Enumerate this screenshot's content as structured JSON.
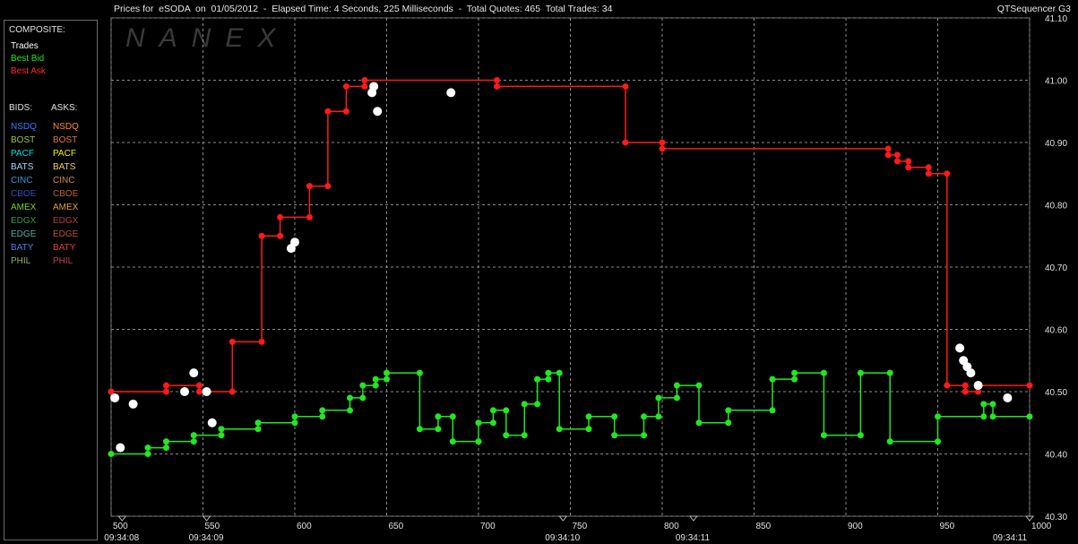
{
  "header": {
    "title": "Prices for  eSODA  on  01/05/2012  -  Elapsed Time: 4 Seconds, 225 Milliseconds  -  Total Quotes: 465  Total Trades: 34",
    "app": "QTSequencer G3"
  },
  "watermark": "NANEX",
  "legend": {
    "composite_title": "COMPOSITE:",
    "trades": "Trades",
    "best_bid": "Best Bid",
    "best_ask": "Best Ask",
    "bids_title": "BIDS:",
    "asks_title": "ASKS:",
    "exchanges": [
      {
        "bid": "NSDQ",
        "ask": "NSDQ",
        "bid_color": "#3a78ff",
        "ask_color": "#ff8a2a"
      },
      {
        "bid": "BOST",
        "ask": "BOST",
        "bid_color": "#9acd32",
        "ask_color": "#e0783a"
      },
      {
        "bid": "PACF",
        "ask": "PACF",
        "bid_color": "#00e0e0",
        "ask_color": "#f0f000"
      },
      {
        "bid": "BATS",
        "ask": "BATS",
        "bid_color": "#a0d8ff",
        "ask_color": "#f0d060"
      },
      {
        "bid": "CINC",
        "ask": "CINC",
        "bid_color": "#3a9bd0",
        "ask_color": "#d08a50"
      },
      {
        "bid": "CBOE",
        "ask": "CBOE",
        "bid_color": "#3050b0",
        "ask_color": "#c06020"
      },
      {
        "bid": "AMEX",
        "ask": "AMEX",
        "bid_color": "#7ad028",
        "ask_color": "#e0a030"
      },
      {
        "bid": "EDGX",
        "ask": "EDGX",
        "bid_color": "#2e9a50",
        "ask_color": "#b04040"
      },
      {
        "bid": "EDGE",
        "ask": "EDGE",
        "bid_color": "#50b0a0",
        "ask_color": "#c05030"
      },
      {
        "bid": "BATY",
        "ask": "BATY",
        "bid_color": "#4080e0",
        "ask_color": "#e04040"
      },
      {
        "bid": "PHIL",
        "ask": "PHIL",
        "bid_color": "#90b060",
        "ask_color": "#c04050"
      }
    ]
  },
  "colors": {
    "trades": "#ffffff",
    "best_bid": "#22e622",
    "best_ask": "#ff1a1a",
    "grid": "#8a8a8a"
  },
  "chart_data": {
    "type": "line",
    "x_ticks": [
      500,
      550,
      600,
      650,
      700,
      750,
      800,
      850,
      900,
      950,
      1000
    ],
    "y_ticks": [
      "40.30",
      "40.40",
      "40.50",
      "40.60",
      "40.70",
      "40.80",
      "40.90",
      "41.00",
      "41.10"
    ],
    "xlim": [
      500,
      1000
    ],
    "ylim": [
      40.3,
      41.1
    ],
    "time_labels": [
      {
        "x": 506,
        "label": "09:34:08"
      },
      {
        "x": 552,
        "label": "09:34:09"
      },
      {
        "x": 746,
        "label": "09:34:10"
      },
      {
        "x": 817,
        "label": "09:34:11"
      },
      {
        "x": 1000,
        "label": "09:34:11"
      }
    ],
    "series": [
      {
        "name": "Best Ask",
        "color": "#ff1a1a",
        "points": [
          [
            500,
            40.5
          ],
          [
            530,
            40.5
          ],
          [
            530,
            40.51
          ],
          [
            548,
            40.51
          ],
          [
            548,
            40.5
          ],
          [
            566,
            40.5
          ],
          [
            566,
            40.58
          ],
          [
            582,
            40.58
          ],
          [
            582,
            40.75
          ],
          [
            592,
            40.75
          ],
          [
            592,
            40.78
          ],
          [
            608,
            40.78
          ],
          [
            608,
            40.83
          ],
          [
            618,
            40.83
          ],
          [
            618,
            40.95
          ],
          [
            628,
            40.95
          ],
          [
            628,
            40.99
          ],
          [
            638,
            40.99
          ],
          [
            638,
            41.0
          ],
          [
            710,
            41.0
          ],
          [
            710,
            40.99
          ],
          [
            780,
            40.99
          ],
          [
            780,
            40.9
          ],
          [
            800,
            40.9
          ],
          [
            800,
            40.89
          ],
          [
            923,
            40.89
          ],
          [
            923,
            40.88
          ],
          [
            928,
            40.88
          ],
          [
            928,
            40.87
          ],
          [
            934,
            40.87
          ],
          [
            934,
            40.86
          ],
          [
            945,
            40.86
          ],
          [
            945,
            40.85
          ],
          [
            955,
            40.85
          ],
          [
            955,
            40.51
          ],
          [
            965,
            40.51
          ],
          [
            965,
            40.5
          ],
          [
            972,
            40.5
          ],
          [
            972,
            40.51
          ],
          [
            1000,
            40.51
          ]
        ]
      },
      {
        "name": "Best Bid",
        "color": "#22e622",
        "points": [
          [
            500,
            40.4
          ],
          [
            520,
            40.4
          ],
          [
            520,
            40.41
          ],
          [
            530,
            40.41
          ],
          [
            530,
            40.42
          ],
          [
            545,
            40.42
          ],
          [
            545,
            40.43
          ],
          [
            560,
            40.43
          ],
          [
            560,
            40.44
          ],
          [
            580,
            40.44
          ],
          [
            580,
            40.45
          ],
          [
            600,
            40.45
          ],
          [
            600,
            40.46
          ],
          [
            615,
            40.46
          ],
          [
            615,
            40.47
          ],
          [
            630,
            40.47
          ],
          [
            630,
            40.49
          ],
          [
            637,
            40.49
          ],
          [
            637,
            40.51
          ],
          [
            644,
            40.51
          ],
          [
            644,
            40.52
          ],
          [
            650,
            40.52
          ],
          [
            650,
            40.53
          ],
          [
            668,
            40.53
          ],
          [
            668,
            40.44
          ],
          [
            678,
            40.44
          ],
          [
            678,
            40.46
          ],
          [
            686,
            40.46
          ],
          [
            686,
            40.42
          ],
          [
            700,
            40.42
          ],
          [
            700,
            40.45
          ],
          [
            708,
            40.45
          ],
          [
            708,
            40.47
          ],
          [
            715,
            40.47
          ],
          [
            715,
            40.43
          ],
          [
            725,
            40.43
          ],
          [
            725,
            40.48
          ],
          [
            732,
            40.48
          ],
          [
            732,
            40.52
          ],
          [
            738,
            40.52
          ],
          [
            738,
            40.53
          ],
          [
            744,
            40.53
          ],
          [
            744,
            40.44
          ],
          [
            760,
            40.44
          ],
          [
            760,
            40.46
          ],
          [
            774,
            40.46
          ],
          [
            774,
            40.43
          ],
          [
            790,
            40.43
          ],
          [
            790,
            40.46
          ],
          [
            798,
            40.46
          ],
          [
            798,
            40.49
          ],
          [
            808,
            40.49
          ],
          [
            808,
            40.51
          ],
          [
            820,
            40.51
          ],
          [
            820,
            40.45
          ],
          [
            836,
            40.45
          ],
          [
            836,
            40.47
          ],
          [
            860,
            40.47
          ],
          [
            860,
            40.52
          ],
          [
            872,
            40.52
          ],
          [
            872,
            40.53
          ],
          [
            888,
            40.53
          ],
          [
            888,
            40.43
          ],
          [
            908,
            40.43
          ],
          [
            908,
            40.53
          ],
          [
            924,
            40.53
          ],
          [
            924,
            40.42
          ],
          [
            950,
            40.42
          ],
          [
            950,
            40.46
          ],
          [
            975,
            40.46
          ],
          [
            975,
            40.48
          ],
          [
            980,
            40.48
          ],
          [
            980,
            40.46
          ],
          [
            1000,
            40.46
          ]
        ]
      },
      {
        "name": "Trades",
        "color": "#ffffff",
        "points": [
          [
            502,
            40.49
          ],
          [
            512,
            40.48
          ],
          [
            505,
            40.41
          ],
          [
            540,
            40.5
          ],
          [
            545,
            40.53
          ],
          [
            552,
            40.5
          ],
          [
            555,
            40.45
          ],
          [
            598,
            40.73
          ],
          [
            600,
            40.74
          ],
          [
            642,
            40.98
          ],
          [
            643,
            40.99
          ],
          [
            645,
            40.95
          ],
          [
            685,
            40.98
          ],
          [
            962,
            40.57
          ],
          [
            964,
            40.55
          ],
          [
            966,
            40.54
          ],
          [
            968,
            40.53
          ],
          [
            972,
            40.51
          ],
          [
            988,
            40.49
          ]
        ]
      }
    ]
  }
}
